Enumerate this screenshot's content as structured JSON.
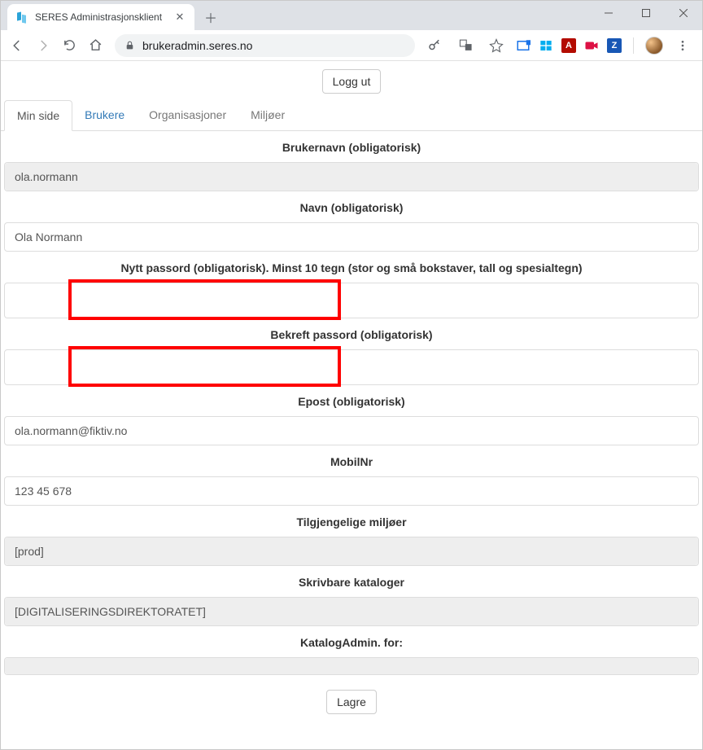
{
  "browser": {
    "tab_title": "SERES Administrasjonsklient",
    "url_host": "brukeradmin.seres.no",
    "url_path": ""
  },
  "header": {
    "logout_label": "Logg ut"
  },
  "tabs": {
    "min_side": "Min side",
    "brukere": "Brukere",
    "organisasjoner": "Organisasjoner",
    "miljoer": "Miljøer"
  },
  "form": {
    "username_label": "Brukernavn (obligatorisk)",
    "username_value": "ola.normann",
    "name_label": "Navn (obligatorisk)",
    "name_value": "Ola Normann",
    "newpass_label": "Nytt passord (obligatorisk). Minst 10 tegn (stor og små bokstaver, tall og spesialtegn)",
    "newpass_value": "",
    "confirmpass_label": "Bekreft passord (obligatorisk)",
    "confirmpass_value": "",
    "email_label": "Epost (obligatorisk)",
    "email_value": "ola.normann@fiktiv.no",
    "mobile_label": "MobilNr",
    "mobile_value": "123 45 678",
    "env_label": "Tilgjengelige miljøer",
    "env_value": "[prod]",
    "catalogs_label": "Skrivbare kataloger",
    "catalogs_value": "[DIGITALISERINGSDIREKTORATET]",
    "catalogadmin_label": "KatalogAdmin. for:",
    "catalogadmin_value": "",
    "save_label": "Lagre"
  }
}
